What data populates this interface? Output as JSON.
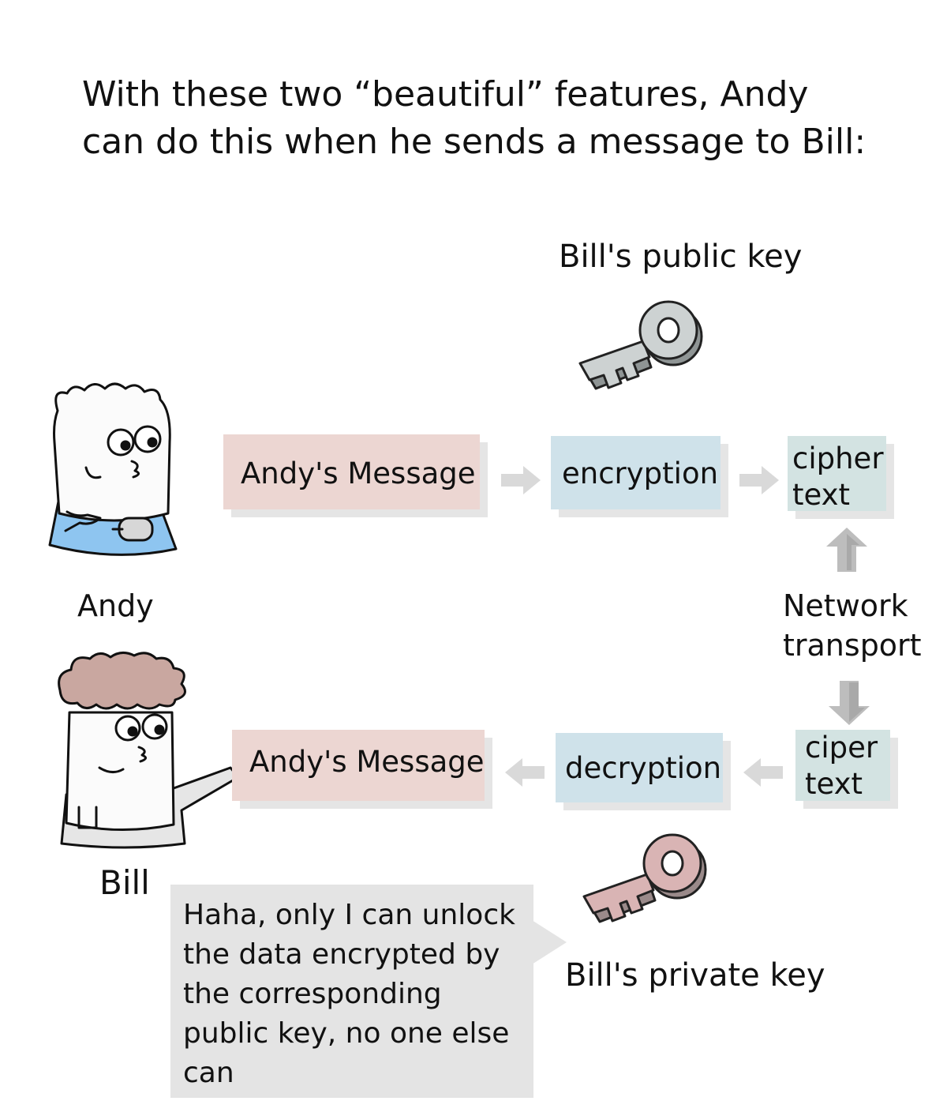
{
  "title": {
    "line1": "With these two  “beautiful” features, Andy",
    "line2": "can do this when he sends a message to Bill:"
  },
  "public_key_label": "Bill's public key",
  "private_key_label": "Bill's private key",
  "andy": {
    "name": "Andy"
  },
  "bill": {
    "name": "Bill"
  },
  "top_flow": {
    "message": "Andy's Message",
    "encryption": "encryption",
    "cipher_line1": "cipher",
    "cipher_line2": "text"
  },
  "network": {
    "line1": "Network",
    "line2": "transport"
  },
  "bottom_flow": {
    "cipher_line1": "ciper",
    "cipher_line2": "text",
    "decryption": "decryption",
    "message": "Andy's Message"
  },
  "speech": "Haha, only I can unlock the data encrypted by the corresponding public key, no one else can",
  "colors": {
    "message_box": "#ecd6d2",
    "process_box": "#cfe2ea",
    "cipher_box": "#d3e3e2",
    "andy_shirt": "#8ec5f0",
    "bill_hair": "#c9a7a0",
    "public_key": "#cdd2d2",
    "private_key": "#d9b4b4"
  }
}
